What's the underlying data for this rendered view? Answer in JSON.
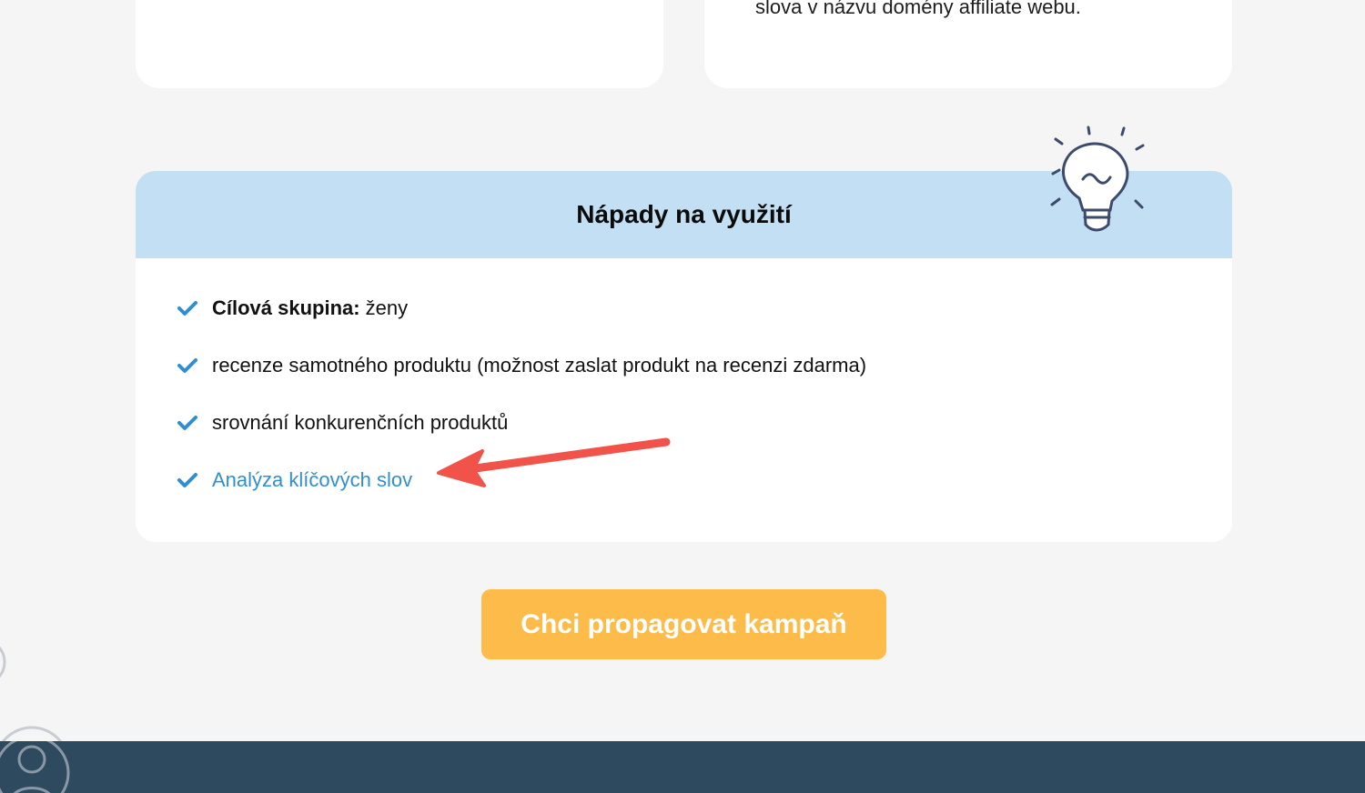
{
  "top_cards": {
    "right_text": "slova v názvu domény affiliate webu."
  },
  "ideas": {
    "title": "Nápady na využití",
    "items": [
      {
        "label": "Cílová skupina:",
        "text": "ženy"
      },
      {
        "text": "recenze samotného produktu (možnost zaslat produkt na recenzi zdarma)"
      },
      {
        "text": "srovnání konkurenčních produktů"
      },
      {
        "link_text": "Analýza klíčových slov"
      }
    ]
  },
  "cta": {
    "label": "Chci propagovat kampaň"
  },
  "colors": {
    "accent_blue": "#2f8fd0",
    "header_blue": "#c2dff3",
    "cta_orange": "#fdbb4a",
    "footer": "#2d4a5e",
    "arrow_red": "#f1524a"
  },
  "icons": [
    "check-icon",
    "lightbulb-icon",
    "red-arrow-annotation",
    "user-avatar-icon"
  ]
}
